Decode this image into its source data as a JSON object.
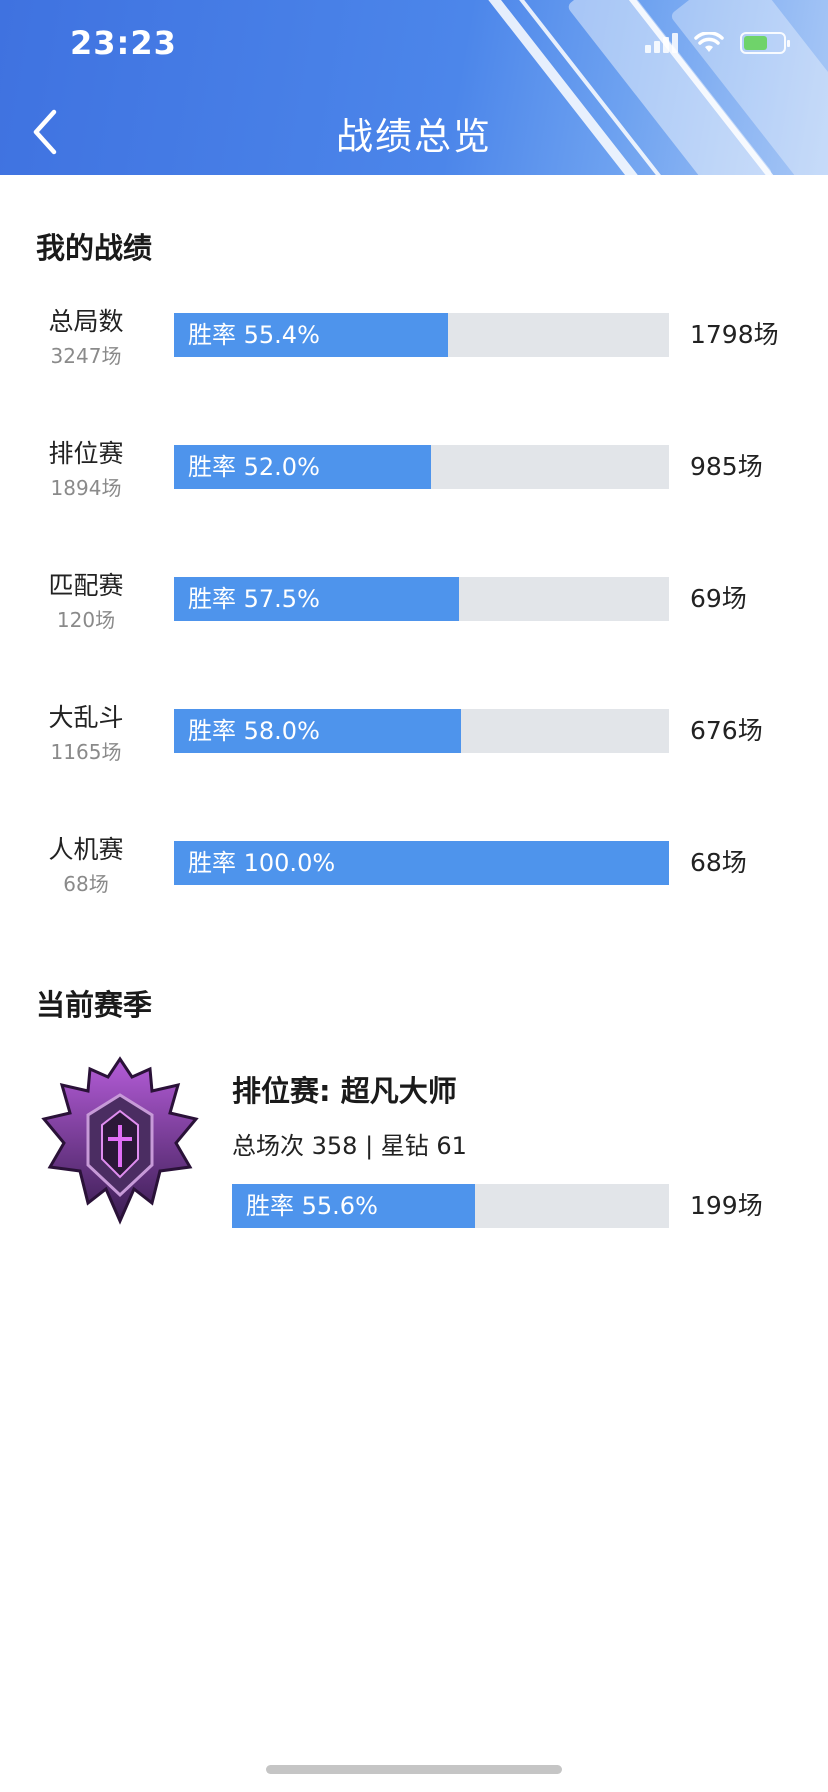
{
  "status_bar": {
    "time": "23:23"
  },
  "header": {
    "title": "战绩总览"
  },
  "my_stats": {
    "title": "我的战绩",
    "rows": [
      {
        "label": "总局数",
        "sub": "3247场",
        "win_rate_text": "胜率 55.4%",
        "win_rate": 55.4,
        "wins": "1798场"
      },
      {
        "label": "排位赛",
        "sub": "1894场",
        "win_rate_text": "胜率 52.0%",
        "win_rate": 52.0,
        "wins": "985场"
      },
      {
        "label": "匹配赛",
        "sub": "120场",
        "win_rate_text": "胜率 57.5%",
        "win_rate": 57.5,
        "wins": "69场"
      },
      {
        "label": "大乱斗",
        "sub": "1165场",
        "win_rate_text": "胜率 58.0%",
        "win_rate": 58.0,
        "wins": "676场"
      },
      {
        "label": "人机赛",
        "sub": "68场",
        "win_rate_text": "胜率 100.0%",
        "win_rate": 100.0,
        "wins": "68场"
      }
    ]
  },
  "current_season": {
    "title": "当前赛季",
    "name": "排位赛: 超凡大师",
    "detail": "总场次 358 | 星钻 61",
    "win_rate_text": "胜率 55.6%",
    "win_rate": 55.6,
    "wins": "199场"
  },
  "colors": {
    "accent": "#4e94ec",
    "bar_track": "#e2e5e9",
    "header": "#4c86ea"
  }
}
